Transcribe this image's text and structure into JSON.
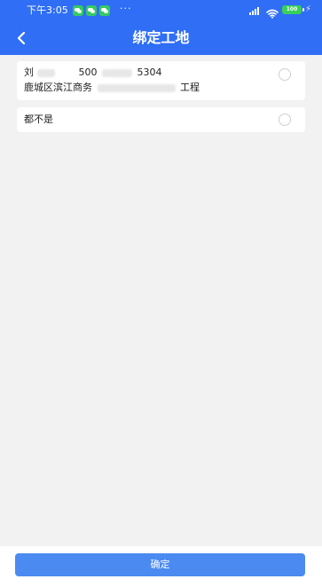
{
  "status_bar": {
    "time": "下午3:05",
    "more": "···",
    "battery": "100"
  },
  "nav_bar": {
    "title": "绑定工地"
  },
  "options": [
    {
      "name_prefix": "刘",
      "id_prefix": "500",
      "id_suffix": "5304",
      "address_prefix": "鹿城区滨江商务",
      "address_suffix": "工程"
    },
    {
      "label": "都不是"
    }
  ],
  "footer": {
    "confirm_label": "确定"
  }
}
